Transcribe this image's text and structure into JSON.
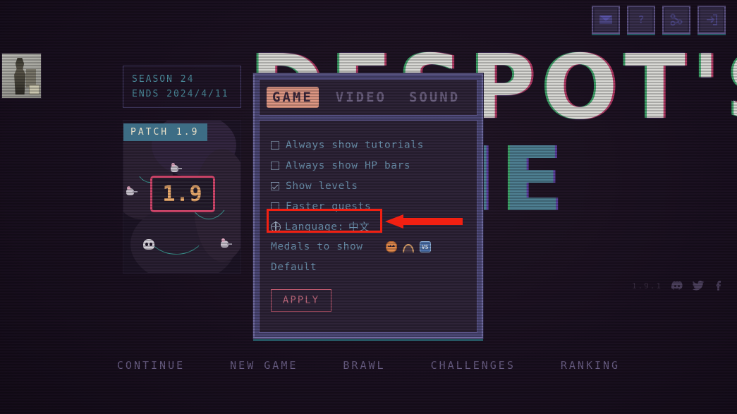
{
  "background": {
    "title_line1": "DESPOT'S",
    "title_line2": "GAME",
    "bg_color": "#1a1020"
  },
  "avatar": {
    "name": "player-avatar"
  },
  "topbar": {
    "buttons": [
      {
        "name": "mail-icon",
        "label": "Mail"
      },
      {
        "name": "help-icon",
        "label": "Help"
      },
      {
        "name": "share-icon",
        "label": "Share"
      },
      {
        "name": "login-icon",
        "label": "Login"
      }
    ]
  },
  "season": {
    "line1": "SEASON 24",
    "line2": "ENDS 2024/4/11",
    "color": "#4d8fa0"
  },
  "patch": {
    "label": "PATCH 1.9",
    "screen_number": "1.9"
  },
  "settings": {
    "tabs": [
      {
        "label": "GAME",
        "active": true
      },
      {
        "label": "VIDEO",
        "active": false
      },
      {
        "label": "SOUND",
        "active": false
      }
    ],
    "active_tab_color": "#dd9683",
    "options": [
      {
        "label": "Always show tutorials",
        "checked": false
      },
      {
        "label": "Always show HP bars",
        "checked": false
      },
      {
        "label": "Show levels",
        "checked": true
      },
      {
        "label": "Faster quests",
        "checked": false
      }
    ],
    "language_row": {
      "label": "Language:",
      "value": "中文"
    },
    "medals_row": {
      "label": "Medals to show",
      "medals": [
        {
          "name": "pumpkin-medal",
          "text": ""
        },
        {
          "name": "arch-medal",
          "text": ""
        },
        {
          "name": "vs-medal",
          "text": "VS"
        }
      ]
    },
    "default_label": "Default",
    "apply_label": "APPLY"
  },
  "annotation": {
    "color": "#f22012",
    "target": "Language: 中文"
  },
  "main_menu": [
    {
      "label": "CONTINUE"
    },
    {
      "label": "NEW GAME"
    },
    {
      "label": "BRAWL"
    },
    {
      "label": "CHALLENGES"
    },
    {
      "label": "RANKING"
    }
  ],
  "footer": {
    "version": "1.9.1",
    "socials": [
      {
        "name": "discord-icon"
      },
      {
        "name": "twitter-icon"
      },
      {
        "name": "facebook-icon"
      }
    ]
  }
}
